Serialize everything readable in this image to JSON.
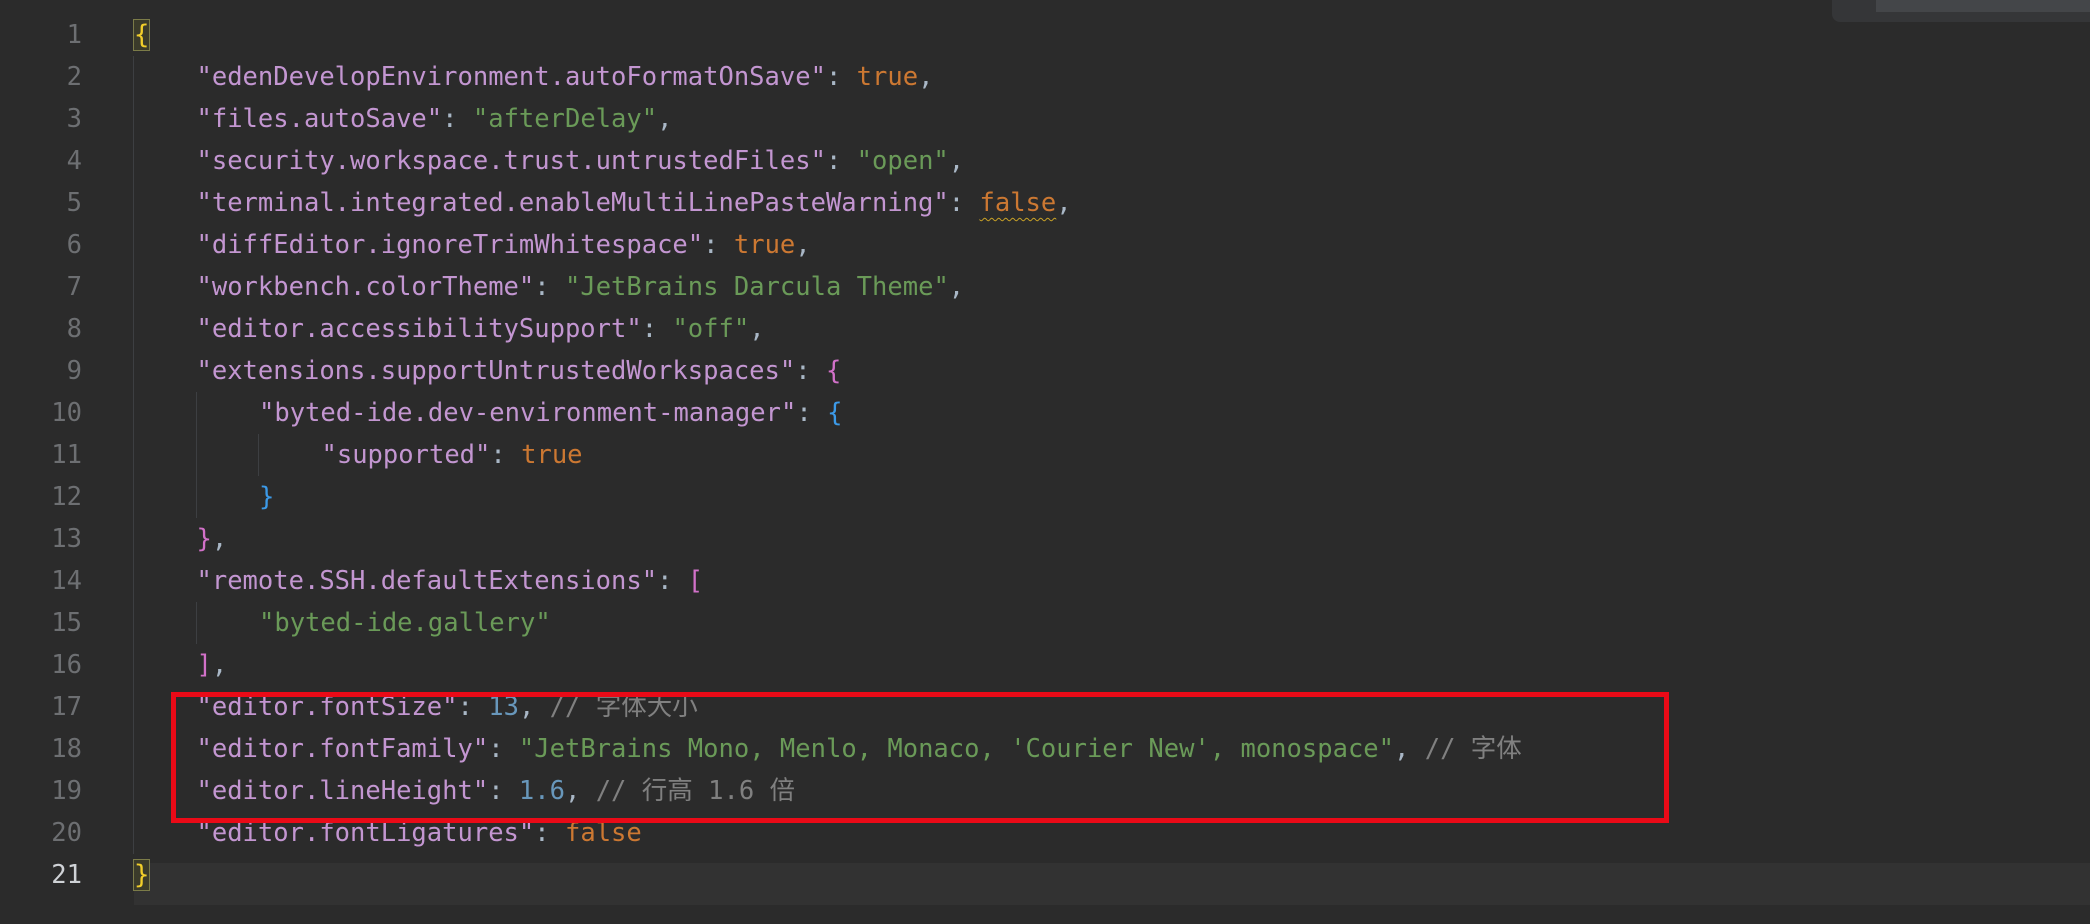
{
  "line_numbers": [
    "1",
    "2",
    "3",
    "4",
    "5",
    "6",
    "7",
    "8",
    "9",
    "10",
    "11",
    "12",
    "13",
    "14",
    "15",
    "16",
    "17",
    "18",
    "19",
    "20",
    "21"
  ],
  "lines": [
    [
      {
        "t": "{",
        "c": "tok-brace-y brace-match"
      }
    ],
    [
      {
        "t": "\"edenDevelopEnvironment.autoFormatOnSave\"",
        "c": "tok-key"
      },
      {
        "t": ": ",
        "c": "tok-punct"
      },
      {
        "t": "true",
        "c": "tok-kw"
      },
      {
        "t": ",",
        "c": "tok-punct"
      }
    ],
    [
      {
        "t": "\"files.autoSave\"",
        "c": "tok-key"
      },
      {
        "t": ": ",
        "c": "tok-punct"
      },
      {
        "t": "\"afterDelay\"",
        "c": "tok-str"
      },
      {
        "t": ",",
        "c": "tok-punct"
      }
    ],
    [
      {
        "t": "\"security.workspace.trust.untrustedFiles\"",
        "c": "tok-key"
      },
      {
        "t": ": ",
        "c": "tok-punct"
      },
      {
        "t": "\"open\"",
        "c": "tok-str"
      },
      {
        "t": ",",
        "c": "tok-punct"
      }
    ],
    [
      {
        "t": "\"terminal.integrated.enableMultiLinePasteWarning\"",
        "c": "tok-key"
      },
      {
        "t": ": ",
        "c": "tok-punct"
      },
      {
        "t": "false",
        "c": "tok-kw squiggle"
      },
      {
        "t": ",",
        "c": "tok-punct"
      }
    ],
    [
      {
        "t": "\"diffEditor.ignoreTrimWhitespace\"",
        "c": "tok-key"
      },
      {
        "t": ": ",
        "c": "tok-punct"
      },
      {
        "t": "true",
        "c": "tok-kw"
      },
      {
        "t": ",",
        "c": "tok-punct"
      }
    ],
    [
      {
        "t": "\"workbench.colorTheme\"",
        "c": "tok-key"
      },
      {
        "t": ": ",
        "c": "tok-punct"
      },
      {
        "t": "\"JetBrains Darcula Theme\"",
        "c": "tok-str"
      },
      {
        "t": ",",
        "c": "tok-punct"
      }
    ],
    [
      {
        "t": "\"editor.accessibilitySupport\"",
        "c": "tok-key"
      },
      {
        "t": ": ",
        "c": "tok-punct"
      },
      {
        "t": "\"off\"",
        "c": "tok-str"
      },
      {
        "t": ",",
        "c": "tok-punct"
      }
    ],
    [
      {
        "t": "\"extensions.supportUntrustedWorkspaces\"",
        "c": "tok-key"
      },
      {
        "t": ": ",
        "c": "tok-punct"
      },
      {
        "t": "{",
        "c": "tok-brace-p"
      }
    ],
    [
      {
        "t": "\"byted-ide.dev-environment-manager\"",
        "c": "tok-key"
      },
      {
        "t": ": ",
        "c": "tok-punct"
      },
      {
        "t": "{",
        "c": "tok-brace-b"
      }
    ],
    [
      {
        "t": "\"supported\"",
        "c": "tok-key"
      },
      {
        "t": ": ",
        "c": "tok-punct"
      },
      {
        "t": "true",
        "c": "tok-kw"
      }
    ],
    [
      {
        "t": "}",
        "c": "tok-brace-b"
      }
    ],
    [
      {
        "t": "}",
        "c": "tok-brace-p"
      },
      {
        "t": ",",
        "c": "tok-punct"
      }
    ],
    [
      {
        "t": "\"remote.SSH.defaultExtensions\"",
        "c": "tok-key"
      },
      {
        "t": ": ",
        "c": "tok-punct"
      },
      {
        "t": "[",
        "c": "tok-brace-p"
      }
    ],
    [
      {
        "t": "\"byted-ide.gallery\"",
        "c": "tok-str"
      }
    ],
    [
      {
        "t": "]",
        "c": "tok-brace-p"
      },
      {
        "t": ",",
        "c": "tok-punct"
      }
    ],
    [
      {
        "t": "\"editor.fontSize\"",
        "c": "tok-key"
      },
      {
        "t": ": ",
        "c": "tok-punct"
      },
      {
        "t": "13",
        "c": "tok-num"
      },
      {
        "t": ", ",
        "c": "tok-punct"
      },
      {
        "t": "// 字体大小",
        "c": "tok-com"
      }
    ],
    [
      {
        "t": "\"editor.fontFamily\"",
        "c": "tok-key"
      },
      {
        "t": ": ",
        "c": "tok-punct"
      },
      {
        "t": "\"JetBrains Mono, Menlo, Monaco, 'Courier New', monospace\"",
        "c": "tok-str"
      },
      {
        "t": ", ",
        "c": "tok-punct"
      },
      {
        "t": "// 字体",
        "c": "tok-com"
      }
    ],
    [
      {
        "t": "\"editor.lineHeight\"",
        "c": "tok-key"
      },
      {
        "t": ": ",
        "c": "tok-punct"
      },
      {
        "t": "1.6",
        "c": "tok-num"
      },
      {
        "t": ", ",
        "c": "tok-punct"
      },
      {
        "t": "// 行高 1.6 倍",
        "c": "tok-com"
      }
    ],
    [
      {
        "t": "\"editor.fontLigatures\"",
        "c": "tok-key"
      },
      {
        "t": ": ",
        "c": "tok-punct"
      },
      {
        "t": "false",
        "c": "tok-kw"
      }
    ],
    [
      {
        "t": "}",
        "c": "tok-brace-y brace-match"
      }
    ]
  ],
  "indent_levels": [
    0,
    1,
    1,
    1,
    1,
    1,
    1,
    1,
    1,
    2,
    3,
    2,
    1,
    1,
    2,
    1,
    1,
    1,
    1,
    1,
    0
  ],
  "current_line": 21,
  "annotation": {
    "from_line": 17,
    "to_line": 19,
    "color": "#ea0a17"
  }
}
